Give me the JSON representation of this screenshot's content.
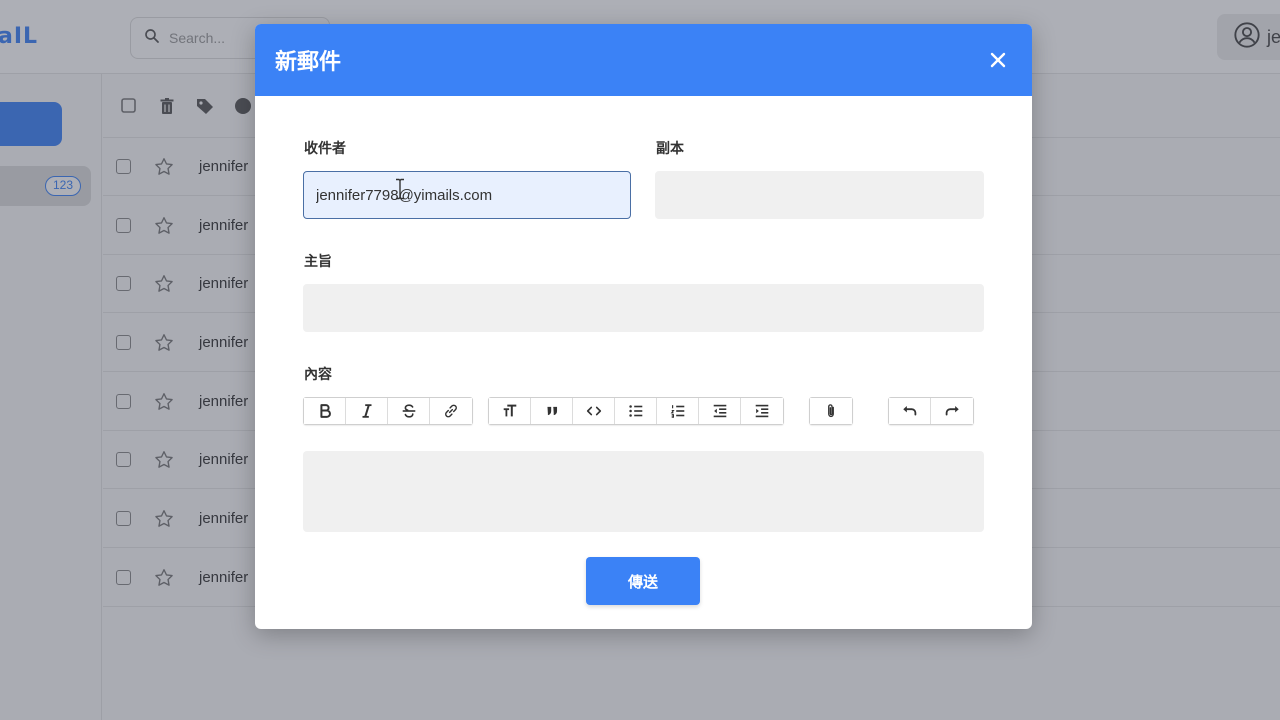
{
  "app": {
    "logo": "aIL",
    "search_placeholder": "Search...",
    "account_initial": "je",
    "inbox_count": "123"
  },
  "email_list": {
    "rows": [
      {
        "sender": "jennifer"
      },
      {
        "sender": "jennifer"
      },
      {
        "sender": "jennifer"
      },
      {
        "sender": "jennifer"
      },
      {
        "sender": "jennifer"
      },
      {
        "sender": "jennifer"
      },
      {
        "sender": "jennifer"
      },
      {
        "sender": "jennifer"
      }
    ]
  },
  "modal": {
    "title": "新郵件",
    "to_label": "收件者",
    "to_value": "jennifer7798@yimails.com",
    "cc_label": "副本",
    "cc_value": "",
    "subject_label": "主旨",
    "subject_value": "",
    "body_label": "內容",
    "send_label": "傳送"
  },
  "colors": {
    "accent": "#3b82f6",
    "focus_border": "#4a6fa5",
    "field_bg": "#f0f0f0"
  }
}
